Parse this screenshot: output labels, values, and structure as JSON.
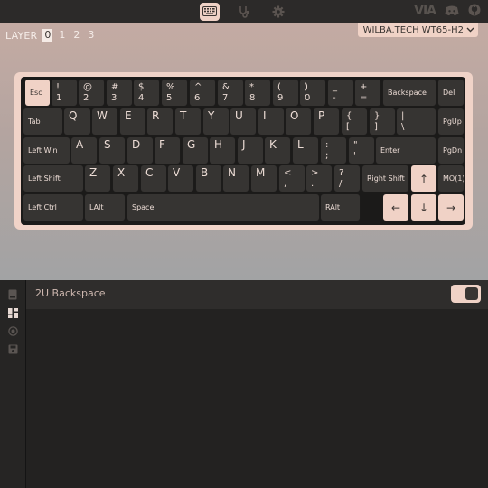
{
  "topbar": {
    "nav": [
      {
        "name": "keyboard-icon",
        "active": true
      },
      {
        "name": "stethoscope-icon",
        "active": false
      },
      {
        "name": "gear-icon",
        "active": false
      }
    ],
    "logo": "VIA",
    "right_icons": [
      "discord-icon",
      "github-icon"
    ]
  },
  "layers": {
    "label": "LAYER",
    "items": [
      "0",
      "1",
      "2",
      "3"
    ],
    "active": "0"
  },
  "device": {
    "name": "WILBA.TECH WT65-H2",
    "chevron": "⌄"
  },
  "keyboard": {
    "rows": [
      [
        {
          "top": "Esc",
          "accent": true,
          "align": "left",
          "style": "text"
        },
        {
          "top": "!",
          "bottom": "1"
        },
        {
          "top": "@",
          "bottom": "2"
        },
        {
          "top": "#",
          "bottom": "3"
        },
        {
          "top": "$",
          "bottom": "4"
        },
        {
          "top": "%",
          "bottom": "5"
        },
        {
          "top": "^",
          "bottom": "6"
        },
        {
          "top": "&",
          "bottom": "7"
        },
        {
          "top": "*",
          "bottom": "8"
        },
        {
          "top": "(",
          "bottom": "9"
        },
        {
          "top": ")",
          "bottom": "0"
        },
        {
          "top": "_",
          "bottom": "-"
        },
        {
          "top": "+",
          "bottom": "="
        },
        {
          "top": "Backspace",
          "style": "text"
        },
        {
          "top": "Del",
          "style": "text"
        }
      ],
      [
        {
          "top": "Tab",
          "style": "text"
        },
        {
          "top": "Q",
          "style": "alpha"
        },
        {
          "top": "W",
          "style": "alpha"
        },
        {
          "top": "E",
          "style": "alpha"
        },
        {
          "top": "R",
          "style": "alpha"
        },
        {
          "top": "T",
          "style": "alpha"
        },
        {
          "top": "Y",
          "style": "alpha"
        },
        {
          "top": "U",
          "style": "alpha"
        },
        {
          "top": "I",
          "style": "alpha"
        },
        {
          "top": "O",
          "style": "alpha"
        },
        {
          "top": "P",
          "style": "alpha"
        },
        {
          "top": "{",
          "bottom": "["
        },
        {
          "top": "}",
          "bottom": "]"
        },
        {
          "top": "|",
          "bottom": "\\"
        },
        {
          "top": "PgUp",
          "style": "text"
        }
      ],
      [
        {
          "top": "Left Win",
          "style": "text"
        },
        {
          "top": "A",
          "style": "alpha"
        },
        {
          "top": "S",
          "style": "alpha"
        },
        {
          "top": "D",
          "style": "alpha"
        },
        {
          "top": "F",
          "style": "alpha"
        },
        {
          "top": "G",
          "style": "alpha"
        },
        {
          "top": "H",
          "style": "alpha"
        },
        {
          "top": "J",
          "style": "alpha"
        },
        {
          "top": "K",
          "style": "alpha"
        },
        {
          "top": "L",
          "style": "alpha"
        },
        {
          "top": ":",
          "bottom": ";"
        },
        {
          "top": "\"",
          "bottom": "'"
        },
        {
          "top": "Enter",
          "style": "text"
        },
        {
          "top": "PgDn",
          "style": "text"
        }
      ],
      [
        {
          "top": "Left Shift",
          "style": "text"
        },
        {
          "top": "Z",
          "style": "alpha"
        },
        {
          "top": "X",
          "style": "alpha"
        },
        {
          "top": "C",
          "style": "alpha"
        },
        {
          "top": "V",
          "style": "alpha"
        },
        {
          "top": "B",
          "style": "alpha"
        },
        {
          "top": "N",
          "style": "alpha"
        },
        {
          "top": "M",
          "style": "alpha"
        },
        {
          "top": "<",
          "bottom": ","
        },
        {
          "top": ">",
          "bottom": "."
        },
        {
          "top": "?",
          "bottom": "/"
        },
        {
          "top": "Right Shift",
          "style": "text"
        },
        {
          "top": "↑",
          "accent": true,
          "style": "single"
        },
        {
          "top": "MO(1)",
          "style": "text"
        }
      ],
      [
        {
          "top": "Left Ctrl",
          "style": "text"
        },
        {
          "top": "LAlt",
          "style": "text"
        },
        {
          "top": "Space",
          "style": "text"
        },
        {
          "top": "RAlt",
          "style": "text"
        },
        {
          "top": "←",
          "accent": true,
          "style": "single"
        },
        {
          "top": "↓",
          "accent": true,
          "style": "single"
        },
        {
          "top": "→",
          "accent": true,
          "style": "single"
        }
      ]
    ]
  },
  "sidebar": {
    "items": [
      {
        "name": "book-icon"
      },
      {
        "name": "layout-icon",
        "active": true
      },
      {
        "name": "circle-icon"
      },
      {
        "name": "save-icon"
      }
    ]
  },
  "panel": {
    "option_label": "2U Backspace",
    "toggle_on": true
  },
  "colors": {
    "accent": "#f0d2c6",
    "key": "#363432",
    "case": "#f0d3c8",
    "plate": "#1b1a19"
  }
}
